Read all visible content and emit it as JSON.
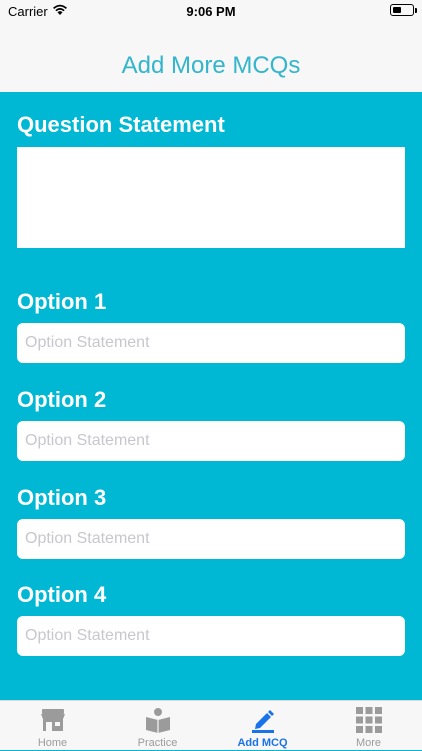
{
  "status": {
    "carrier": "Carrier",
    "time": "9:06 PM"
  },
  "nav": {
    "title": "Add More MCQs"
  },
  "form": {
    "question_label": "Question Statement",
    "options": [
      {
        "label": "Option 1",
        "placeholder": "Option Statement"
      },
      {
        "label": "Option 2",
        "placeholder": "Option Statement"
      },
      {
        "label": "Option 3",
        "placeholder": "Option Statement"
      },
      {
        "label": "Option 4",
        "placeholder": "Option Statement"
      }
    ]
  },
  "tabs": [
    {
      "label": "Home",
      "icon": "store-icon"
    },
    {
      "label": "Practice",
      "icon": "book-reader-icon"
    },
    {
      "label": "Add MCQ",
      "icon": "pencil-icon",
      "active": true
    },
    {
      "label": "More",
      "icon": "grid-icon"
    }
  ],
  "colors": {
    "background": "#00b8d4",
    "title": "#33b5cc",
    "active_tab": "#1a73e8",
    "inactive_tab": "#9b9b9b"
  }
}
